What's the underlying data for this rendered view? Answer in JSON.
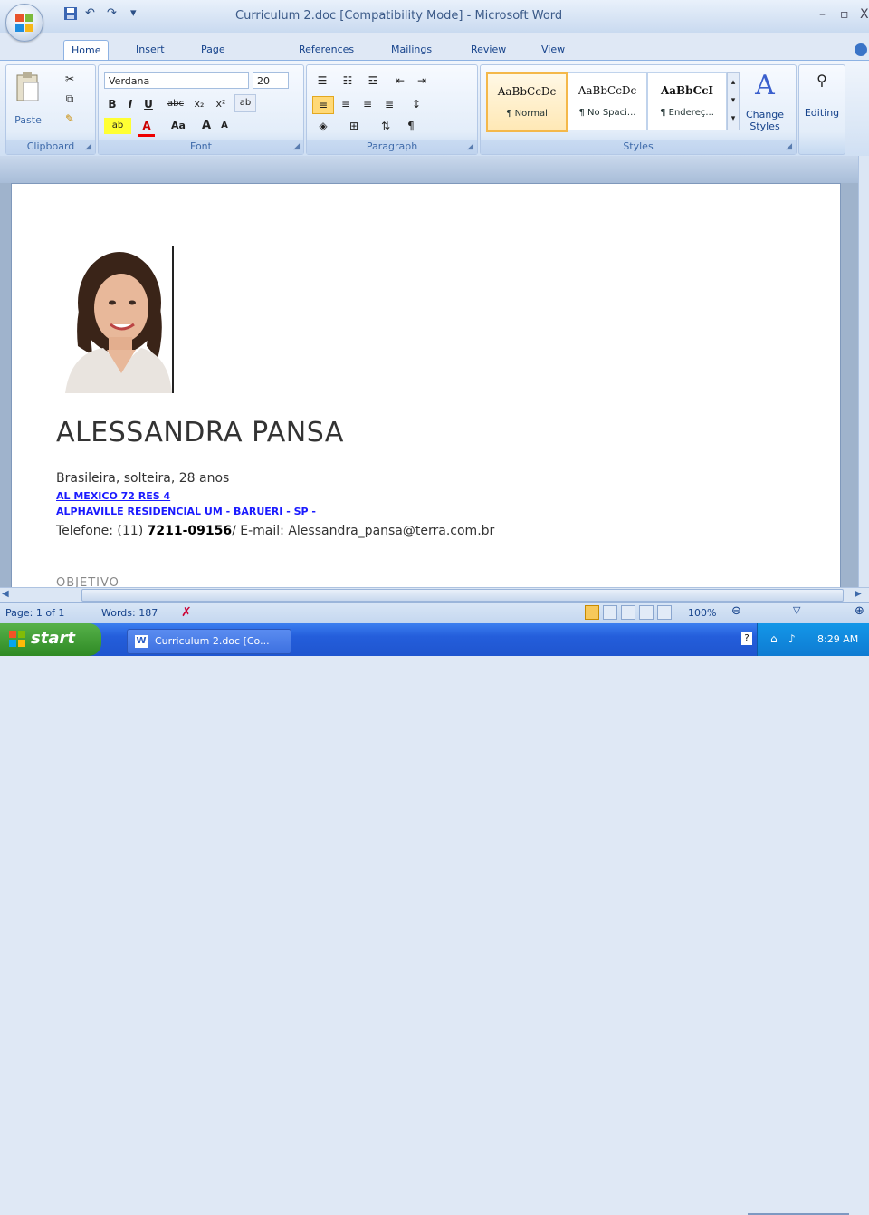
{
  "window": {
    "title": "Curriculum 2.doc [Compatibility Mode] - Microsoft Word",
    "minimize_label": "–",
    "maximize_label": "▫",
    "close_label": "X"
  },
  "tabs": [
    "Home",
    "Insert",
    "Page Layout",
    "References",
    "Mailings",
    "Review",
    "View"
  ],
  "ribbon": {
    "clipboard": {
      "label": "Clipboard",
      "paste_label": "Paste"
    },
    "font": {
      "label": "Font",
      "font_name": "Verdana",
      "font_size": "20",
      "bold": "B",
      "italic": "I",
      "underline": "U",
      "strike": "abc",
      "subscript": "x₂",
      "superscript": "x²",
      "grow": "A",
      "shrink": "A",
      "case": "Aa"
    },
    "paragraph": {
      "label": "Paragraph"
    },
    "styles": {
      "label": "Styles",
      "items": [
        {
          "sample": "AaBbCcDc",
          "name": "¶ Normal"
        },
        {
          "sample": "AaBbCcDc",
          "name": "¶ No Spaci..."
        },
        {
          "sample": "AaBbCcI",
          "name": "¶ Endereç..."
        }
      ],
      "change_styles": "Change Styles",
      "editing": "Editing"
    }
  },
  "document": {
    "name": "ALESSANDRA PANSA",
    "line1": "Brasileira, solteira, 28 anos",
    "address1": "AL MEXICO 72 RES 4 ",
    "address2": "ALPHAVILLE  RESIDENCIAL  UM - BARUERI - SP - ",
    "phone_prefix": "Telefone: (11) ",
    "phone_number": "7211-09156",
    "phone_suffix": "/ E-mail:  Alessandra_pansa@terra.com.br",
    "next_heading": "OBJETIVO"
  },
  "status": {
    "page": "Page: 1 of 1",
    "words": "Words: 187",
    "zoom": "100%"
  },
  "taskbar": {
    "start": "start",
    "task": "Curriculum 2.doc [Co...",
    "time": "8:29 AM"
  },
  "colors": {
    "ribbon_bg": "#dbe7f6",
    "link_blue": "#1a1aff",
    "taskbar_blue": "#245edb",
    "start_green": "#3c9a2e"
  }
}
